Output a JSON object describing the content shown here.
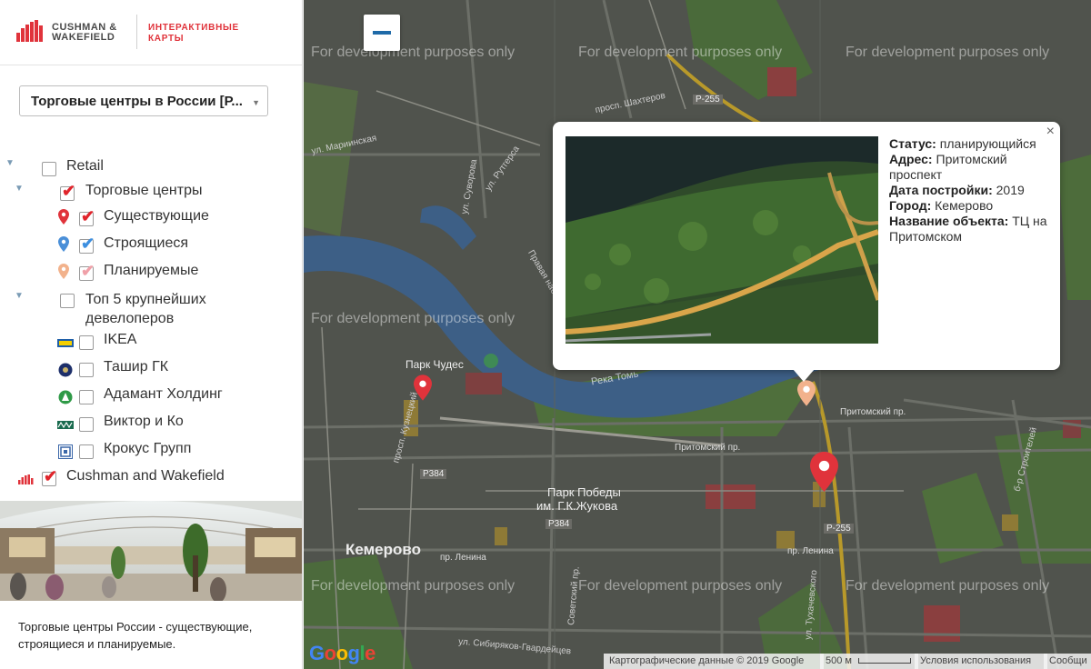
{
  "brand": {
    "name_line1": "CUSHMAN &",
    "name_line2": "WAKEFIELD",
    "sub_line1": "ИНТЕРАКТИВНЫЕ",
    "sub_line2": "КАРТЫ"
  },
  "layer_select": {
    "value": "Торговые центры в России [Р..."
  },
  "tree": {
    "retail": "Retail",
    "malls": "Торговые центры",
    "existing": "Существующие",
    "building": "Строящиеся",
    "planned": "Планируемые",
    "top5_line1": "Топ 5 крупнейших",
    "top5_line2": "девелоперов",
    "ikea": "IKEA",
    "tashir": "Ташир ГК",
    "adamant": "Адамант Холдинг",
    "victor": "Виктор и Ко",
    "crocus": "Крокус Групп",
    "cw": "Cushman and Wakefield"
  },
  "promo": {
    "text": "Торговые центры России - существующие, строящиеся и планируемые."
  },
  "map": {
    "watermark": "For development purposes only",
    "labels": {
      "park_chudes": "Парк Чудес",
      "park_pobedy_1": "Парк Победы",
      "park_pobedy_2": "им. Г.К.Жукова",
      "city": "Кемерово",
      "river": "Река Томь",
      "pritomsky": "Притомский пр.",
      "pritomsky2": "Притомский пр.",
      "lenina": "пр. Ленина",
      "lenina2": "пр. Ленина",
      "r255a": "Р-255",
      "r255b": "Р-255",
      "p384a": "Р384",
      "p384b": "Р384",
      "kuznetsky": "просп. Кузнецкий",
      "shakhterov": "просп. Шахтеров",
      "rutgersa": "ул. Рутгерса",
      "suvorova": "ул. Суворова",
      "marinskaya": "ул. Мариинская",
      "sibiryakov": "ул. Сибиряков-Гвардейцев",
      "sovetsky": "Советский пр.",
      "tukhach": "ул. Тухачевского",
      "stroiteley": "б-р Строителей",
      "pravaya": "Правая набер."
    },
    "popup": {
      "status_label": "Статус:",
      "status": "планирующийся",
      "address_label": "Адрес:",
      "address": "Притомский проспект",
      "year_label": "Дата постройки:",
      "year": "2019",
      "city_label": "Город:",
      "city": "Кемерово",
      "name_label": "Название объекта:",
      "name": "ТЦ на Притомском",
      "close": "×"
    },
    "attribution": {
      "map_data": "Картографические данные © 2019 Google",
      "scale": "500 м",
      "terms": "Условия использования",
      "report": "Сообщи"
    },
    "google_logo": "Google"
  },
  "colors": {
    "brand_red": "#e0333b",
    "check_red": "#e0242b",
    "check_blue": "#3d8fe0",
    "check_pink": "#f0a0a8"
  }
}
